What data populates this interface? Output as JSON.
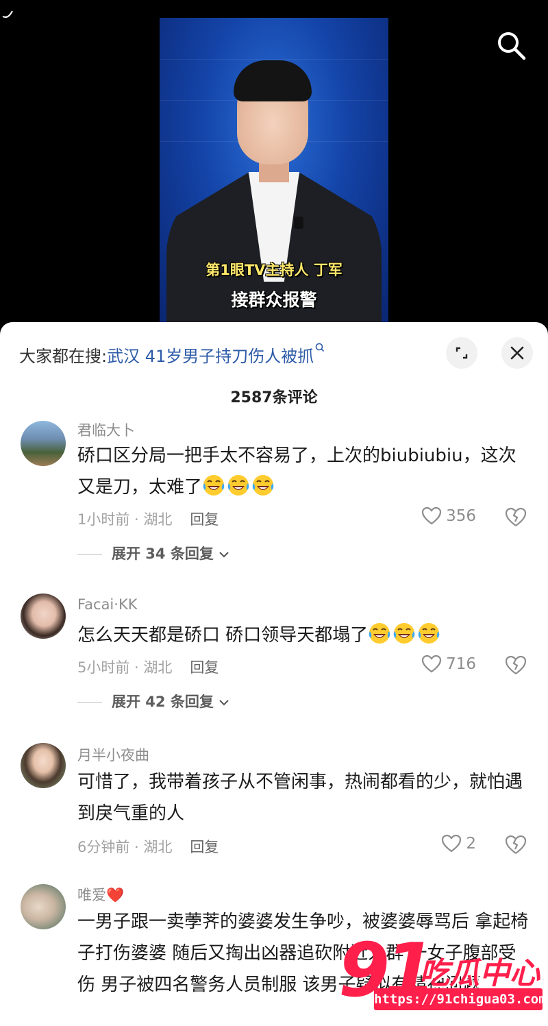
{
  "video": {
    "caption_line1": "第1眼TV主持人 丁军",
    "caption_line2": "接群众报警"
  },
  "search_bar": {
    "prefix": "大家都在搜:",
    "query": "武汉 41岁男子持刀伤人被抓"
  },
  "comment_count": "2587条评论",
  "comments": [
    {
      "username": "君临大卜",
      "text": "硚口区分局一把手太不容易了，上次的biubiubiu，这次又是刀，太难了",
      "emoji_count": 3,
      "time_location": "1小时前 · 湖北",
      "reply_label": "回复",
      "likes": "356",
      "expand_label": "展开 34 条回复"
    },
    {
      "username": "Facai·KK",
      "text": "怎么天天都是硚口 硚口领导天都塌了",
      "emoji_count": 3,
      "time_location": "5小时前 · 湖北",
      "reply_label": "回复",
      "likes": "716",
      "expand_label": "展开 42 条回复"
    },
    {
      "username": "月半小夜曲",
      "text": "可惜了，我带着孩子从不管闲事，热闹都看的少，就怕遇到戾气重的人",
      "time_location": "6分钟前 · 湖北",
      "reply_label": "回复",
      "likes": "2"
    },
    {
      "username": "唯爱❤️",
      "text": "一男子跟一卖荸荠的婆婆发生争吵，被婆婆辱骂后 拿起椅子打伤婆婆 随后又掏出凶器追砍附近人群 一女子腹部受伤 男子被四名警务人员制服 该男子疑似有精神问题"
    }
  ],
  "watermark": {
    "number": "91",
    "text": "吃瓜中心",
    "url": "https://91chigua03.com"
  },
  "colors": {
    "link": "#2c5aa8",
    "watermark": "#ff1f4b"
  },
  "icons": [
    "search-icon",
    "expand-icon",
    "close-icon",
    "heart-icon",
    "broken-heart-icon",
    "chevron-down-icon",
    "laughing-crying-emoji"
  ]
}
